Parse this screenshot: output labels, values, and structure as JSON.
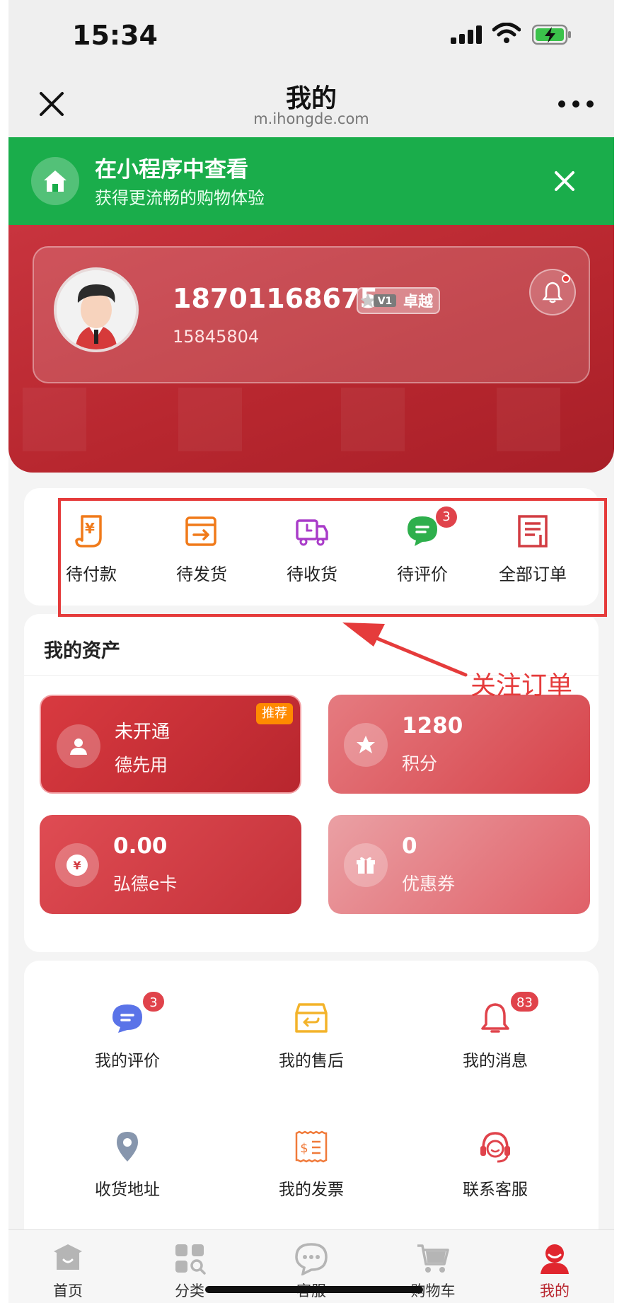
{
  "status_bar": {
    "time": "15:34"
  },
  "navbar": {
    "title": "我的",
    "subtitle": "m.ihongde.com"
  },
  "banner": {
    "title": "在小程序中查看",
    "subtitle": "获得更流畅的购物体验"
  },
  "profile": {
    "phone": "18701168675",
    "vip_label": "卓越",
    "vip_level_icon": "v1-badge-icon",
    "user_id": "15845804"
  },
  "orders": {
    "items": [
      {
        "label": "待付款",
        "icon": "payment-icon"
      },
      {
        "label": "待发货",
        "icon": "ship-icon"
      },
      {
        "label": "待收货",
        "icon": "delivery-truck-icon"
      },
      {
        "label": "待评价",
        "icon": "comment-icon",
        "badge": "3"
      },
      {
        "label": "全部订单",
        "icon": "order-list-icon"
      }
    ]
  },
  "annotation": {
    "text": "关注订单"
  },
  "assets": {
    "title": "我的资产",
    "cards": [
      {
        "value": "未开通",
        "label": "德先用",
        "tag": "推荐",
        "icon": "user-icon"
      },
      {
        "value": "1280",
        "label": "积分",
        "icon": "star-icon"
      },
      {
        "value": "0.00",
        "label": "弘德e卡",
        "icon": "yuan-icon"
      },
      {
        "value": "0",
        "label": "优惠券",
        "icon": "gift-icon"
      }
    ]
  },
  "services": {
    "items": [
      {
        "label": "我的评价",
        "icon": "review-icon",
        "badge": "3"
      },
      {
        "label": "我的售后",
        "icon": "after-sale-icon"
      },
      {
        "label": "我的消息",
        "icon": "bell-icon",
        "badge": "83"
      },
      {
        "label": "收货地址",
        "icon": "location-icon"
      },
      {
        "label": "我的发票",
        "icon": "invoice-icon"
      },
      {
        "label": "联系客服",
        "icon": "headset-icon"
      }
    ]
  },
  "tabbar": {
    "items": [
      {
        "label": "首页",
        "icon": "home-icon"
      },
      {
        "label": "分类",
        "icon": "category-icon"
      },
      {
        "label": "客服",
        "icon": "chat-icon"
      },
      {
        "label": "购物车",
        "icon": "cart-icon"
      },
      {
        "label": "我的",
        "icon": "profile-icon",
        "active": true
      }
    ]
  },
  "colors": {
    "brand_red": "#b8272f",
    "green_banner": "#1aad4b",
    "badge_red": "#e0434b",
    "annotation_red": "#e53b3b"
  }
}
